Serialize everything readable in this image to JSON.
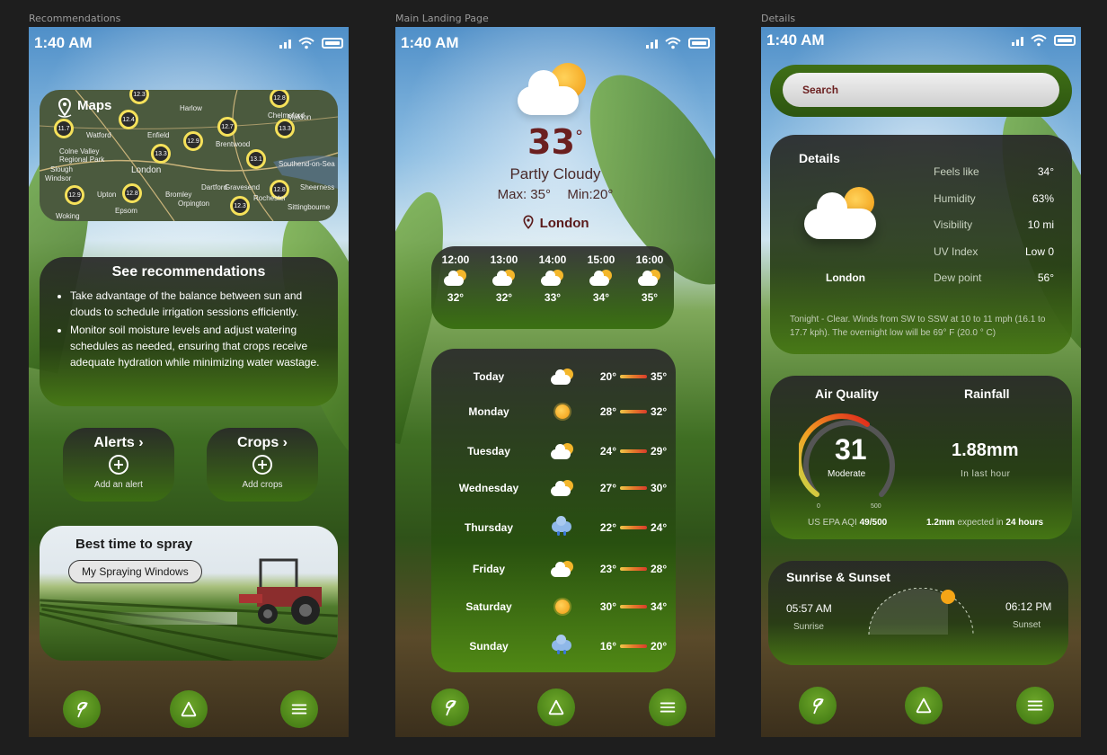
{
  "frames": {
    "recommendations": "Recommendations",
    "main": "Main Landing Page",
    "details": "Details"
  },
  "status": {
    "time": "1:40 AM"
  },
  "colors": {
    "accent_green": "#3c7410",
    "temp_red": "#6b1f1f",
    "sun_orange": "#f19a10"
  },
  "recommendations": {
    "maps_label": "Maps",
    "map_places": [
      "Harlow",
      "Chelmsford",
      "Maldon",
      "Watford",
      "Enfield",
      "Brentwood",
      "Colne Valley Regional Park",
      "London",
      "Southend-on-Sea",
      "Slough",
      "Windsor",
      "Dartford",
      "Gravesend",
      "Sheerness",
      "Woking",
      "Epsom",
      "Upton",
      "Bromley",
      "Orpington",
      "Rochester",
      "Sittingbourne"
    ],
    "map_markers": [
      "12.3",
      "12.8",
      "11.7",
      "12.4",
      "12.7",
      "13.3",
      "12.9",
      "13.3",
      "13.1",
      "12.9",
      "12.8",
      "12.8",
      "12.3"
    ],
    "see_title": "See recommendations",
    "items": [
      "Take advantage of the balance between sun and clouds to schedule irrigation sessions efficiently.",
      "Monitor soil moisture levels and adjust watering schedules as needed, ensuring that crops receive adequate hydration while minimizing water wastage."
    ],
    "alerts": {
      "title": "Alerts",
      "sub": "Add an alert"
    },
    "crops": {
      "title": "Crops",
      "sub": "Add crops"
    },
    "spray": {
      "title": "Best time to spray",
      "button": "My Spraying Windows"
    }
  },
  "main": {
    "temperature": "33",
    "degree": "°",
    "condition": "Partly Cloudy",
    "max": "Max: 35°",
    "min": "Min:20°",
    "location": "London",
    "hourly": [
      {
        "time": "12:00",
        "temp": "32°"
      },
      {
        "time": "13:00",
        "temp": "32°"
      },
      {
        "time": "14:00",
        "temp": "33°"
      },
      {
        "time": "15:00",
        "temp": "34°"
      },
      {
        "time": "16:00",
        "temp": "35°"
      }
    ],
    "daily": [
      {
        "day": "Today",
        "icon": "partly-cloudy-icon",
        "lo": "20°",
        "hi": "35°"
      },
      {
        "day": "Monday",
        "icon": "sun-icon",
        "lo": "28°",
        "hi": "32°"
      },
      {
        "day": "Tuesday",
        "icon": "partly-cloudy-icon",
        "lo": "24°",
        "hi": "29°"
      },
      {
        "day": "Wednesday",
        "icon": "partly-cloudy-icon",
        "lo": "27°",
        "hi": "30°"
      },
      {
        "day": "Thursday",
        "icon": "rain-icon",
        "lo": "22°",
        "hi": "24°"
      },
      {
        "day": "Friday",
        "icon": "partly-cloudy-icon",
        "lo": "23°",
        "hi": "28°"
      },
      {
        "day": "Saturday",
        "icon": "sun-icon",
        "lo": "30°",
        "hi": "34°"
      },
      {
        "day": "Sunday",
        "icon": "rain-icon",
        "lo": "16°",
        "hi": "20°"
      }
    ]
  },
  "details": {
    "search_placeholder": "Search",
    "title": "Details",
    "location": "London",
    "stats": [
      {
        "label": "Feels like",
        "value": "34°"
      },
      {
        "label": "Humidity",
        "value": "63%"
      },
      {
        "label": "Visibility",
        "value": "10 mi"
      },
      {
        "label": "UV Index",
        "value": "Low 0"
      },
      {
        "label": "Dew point",
        "value": "56°"
      }
    ],
    "tonight": "Tonight - Clear. Winds from SW to SSW at 10 to 11 mph (16.1 to 17.7 kph). The overnight low will be 69° F (20.0 ° C)",
    "air_quality": {
      "title": "Air Quality",
      "value": "31",
      "level": "Moderate",
      "scale_min": "0",
      "scale_max": "500",
      "footer_prefix": "US EPA AQI",
      "footer_value": "49/500"
    },
    "rainfall": {
      "title": "Rainfall",
      "value": "1.88mm",
      "sub": "In last hour",
      "footer_value": "1.2mm",
      "footer_mid": "expected in",
      "footer_time": "24 hours"
    },
    "sun": {
      "title": "Sunrise & Sunset",
      "sunrise_time": "05:57 AM",
      "sunrise_label": "Sunrise",
      "sunset_time": "06:12 PM",
      "sunset_label": "Sunset"
    }
  }
}
